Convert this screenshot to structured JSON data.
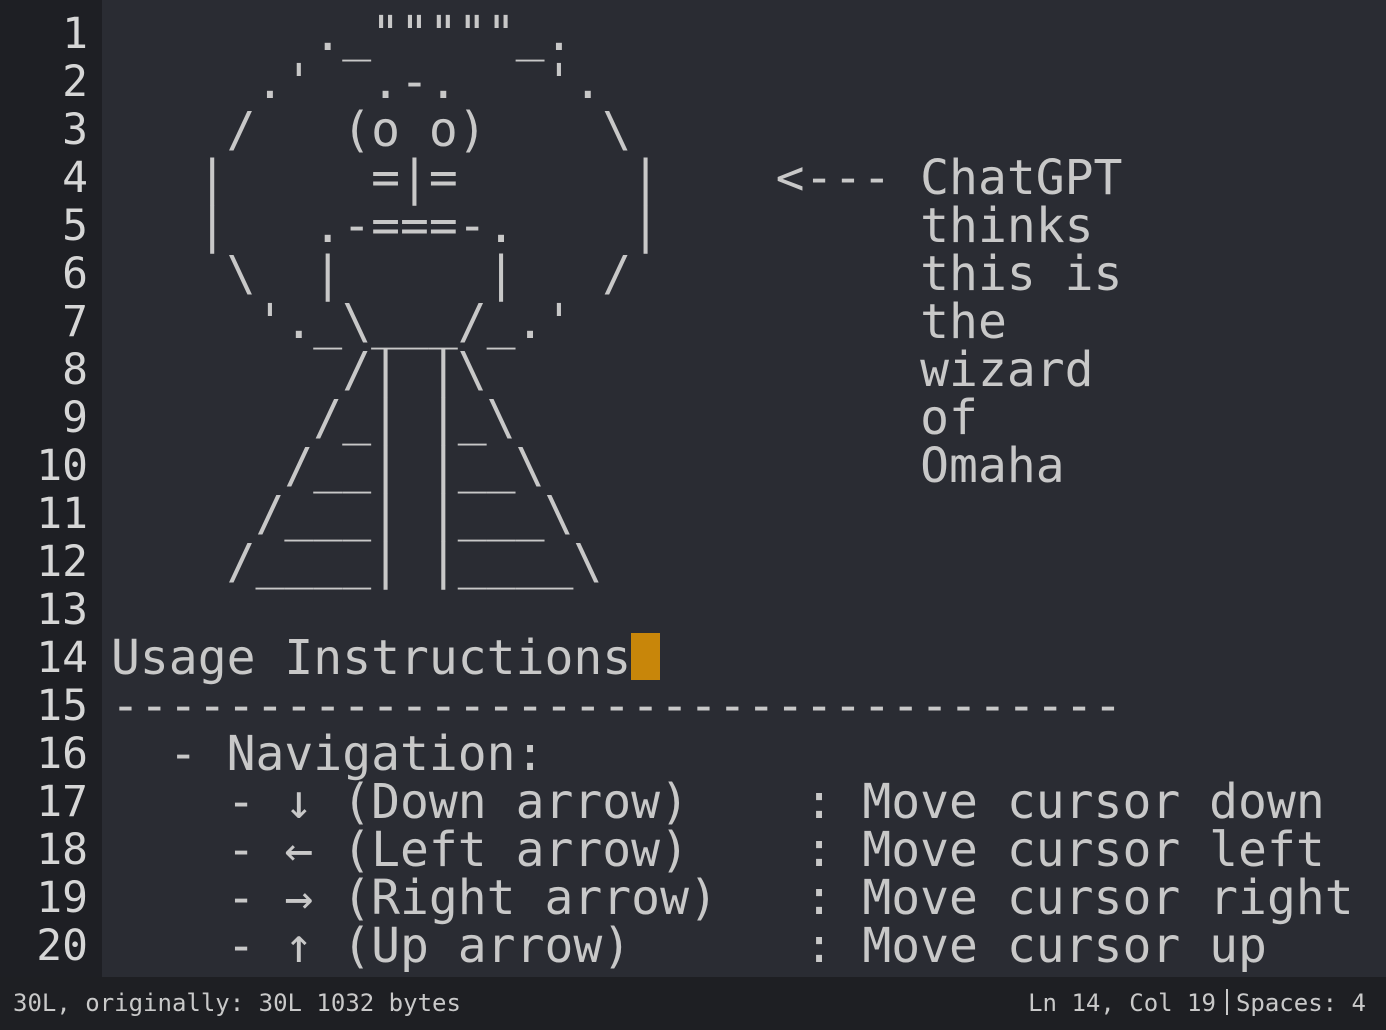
{
  "editor": {
    "lines": [
      {
        "num": "1",
        "text": "       ._\"\"\"\"\"_."
      },
      {
        "num": "2",
        "text": "     .'  .-.   '."
      },
      {
        "num": "3",
        "text": "    /   (o o)    \\"
      },
      {
        "num": "4",
        "text": "   |     =|=      |    <--- ChatGPT"
      },
      {
        "num": "5",
        "text": "   |   .-===-.    |         thinks"
      },
      {
        "num": "6",
        "text": "    \\  |     |   /          this is"
      },
      {
        "num": "7",
        "text": "     '._\\___/_.'            the"
      },
      {
        "num": "8",
        "text": "        /| |\\               wizard"
      },
      {
        "num": "9",
        "text": "       /_| |_\\              of"
      },
      {
        "num": "10",
        "text": "      /__| |__\\             Omaha"
      },
      {
        "num": "11",
        "text": "     /___| |___\\"
      },
      {
        "num": "12",
        "text": "    /____| |____\\"
      },
      {
        "num": "13",
        "text": ""
      },
      {
        "num": "14",
        "text": "Usage Instructions"
      },
      {
        "num": "15",
        "text": "-----------------------------------"
      },
      {
        "num": "16",
        "text": "  - Navigation:"
      },
      {
        "num": "17",
        "text": "    - ↓ (Down arrow)    : Move cursor down"
      },
      {
        "num": "18",
        "text": "    - ← (Left arrow)    : Move cursor left"
      },
      {
        "num": "19",
        "text": "    - → (Right arrow)   : Move cursor right"
      },
      {
        "num": "20",
        "text": "    - ↑ (Up arrow)      : Move cursor up"
      }
    ],
    "cursor_color": "#c8860a"
  },
  "statusbar": {
    "file_info": "30L, originally: 30L 1032 bytes",
    "position": "Ln 14, Col 19",
    "indent": "Spaces: 4"
  }
}
